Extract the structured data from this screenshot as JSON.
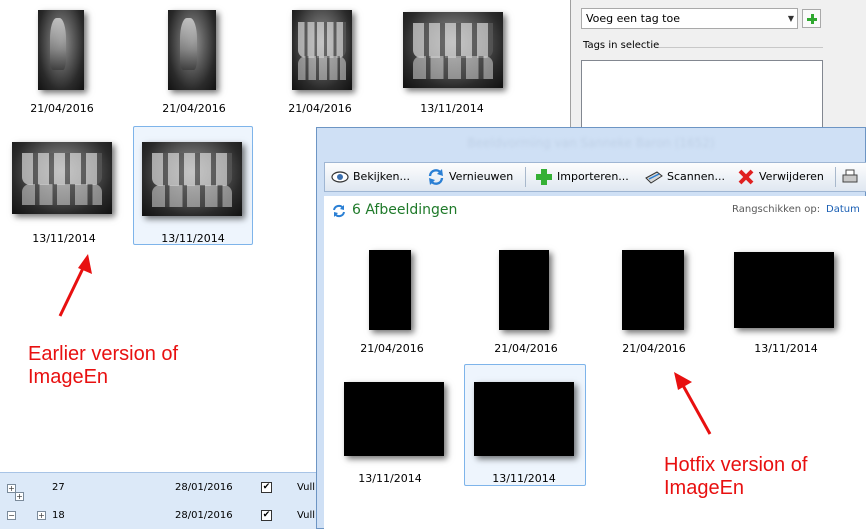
{
  "earlier_gallery": {
    "thumbnails": [
      {
        "date": "21/04/2016"
      },
      {
        "date": "21/04/2016"
      },
      {
        "date": "21/04/2016"
      },
      {
        "date": "13/11/2014"
      },
      {
        "date": "13/11/2014"
      },
      {
        "date": "13/11/2014"
      }
    ]
  },
  "annotations": {
    "earlier": "Earlier version of\nImageEn",
    "hotfix": "Hotfix version of\nImageEn"
  },
  "tag_panel": {
    "tag_select_value": "Voeg een tag toe",
    "tags_in_selection_label": "Tags in selectie"
  },
  "list": {
    "rows": [
      {
        "id": "27",
        "date": "28/01/2016",
        "checked": true,
        "desc": "Vull"
      },
      {
        "id": "18",
        "date": "28/01/2016",
        "checked": true,
        "desc": "Vull"
      }
    ]
  },
  "hotfix_window": {
    "title": "Beeldvorming van Sanneke Baron (1652)",
    "toolbar": {
      "view": "Bekijken...",
      "refresh": "Vernieuwen",
      "import": "Importeren...",
      "scan": "Scannen...",
      "delete": "Verwijderen"
    },
    "count_title": "6 Afbeeldingen",
    "sort_label": "Rangschikken op:",
    "sort_value": "Datum",
    "thumbnails": [
      {
        "date": "21/04/2016"
      },
      {
        "date": "21/04/2016"
      },
      {
        "date": "21/04/2016"
      },
      {
        "date": "13/11/2014"
      },
      {
        "date": "13/11/2014"
      },
      {
        "date": "13/11/2014"
      }
    ]
  },
  "colors": {
    "annotation_red": "#e81010",
    "count_green": "#1f7a2a",
    "selection_blue": "#7eb4ea",
    "arrow_red": "#e81010"
  }
}
